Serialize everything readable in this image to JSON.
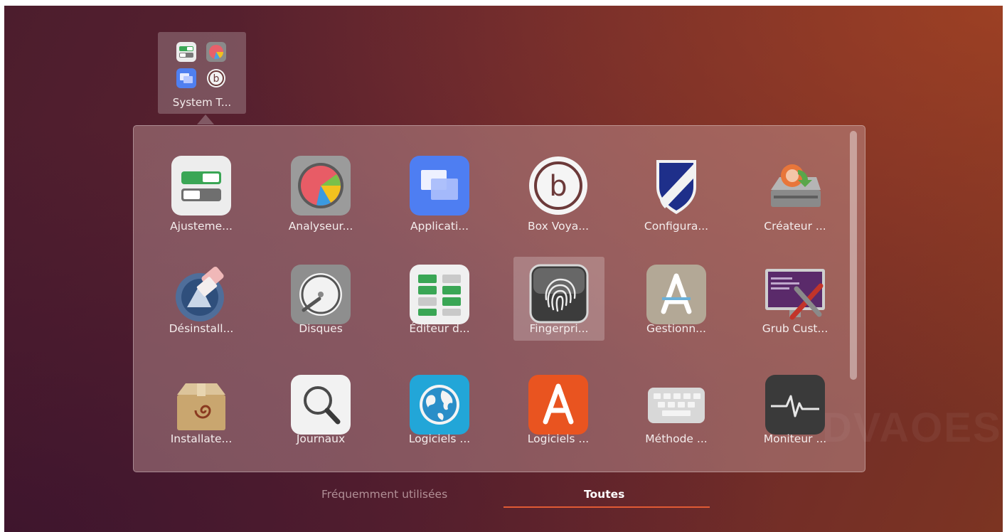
{
  "folder": {
    "label": "System T...",
    "mini_icons": [
      "switch-icon",
      "pie-chart-icon",
      "windows-icon",
      "box-b-icon"
    ]
  },
  "apps": [
    {
      "label": "Ajusteme...",
      "icon": "switch-toggle-icon"
    },
    {
      "label": "Analyseur...",
      "icon": "pie-chart-icon"
    },
    {
      "label": "Applicati...",
      "icon": "windows-icon"
    },
    {
      "label": "Box Voya...",
      "icon": "box-b-icon"
    },
    {
      "label": "Configura...",
      "icon": "shield-icon"
    },
    {
      "label": "Créateur ...",
      "icon": "disk-creator-icon"
    },
    {
      "label": "Désinstall...",
      "icon": "uninstaller-icon"
    },
    {
      "label": "Disques",
      "icon": "disk-icon"
    },
    {
      "label": "Éditeur d...",
      "icon": "grid-editor-icon"
    },
    {
      "label": "Fingerpri...",
      "icon": "fingerprint-icon"
    },
    {
      "label": "Gestionn...",
      "icon": "software-manager-icon"
    },
    {
      "label": "Grub Cust...",
      "icon": "grub-customizer-icon"
    },
    {
      "label": "Installate...",
      "icon": "package-installer-icon"
    },
    {
      "label": "Journaux",
      "icon": "magnifier-icon"
    },
    {
      "label": "Logiciels ...",
      "icon": "globe-icon"
    },
    {
      "label": "Logiciels ...",
      "icon": "ubuntu-software-icon"
    },
    {
      "label": "Méthode ...",
      "icon": "keyboard-icon"
    },
    {
      "label": "Moniteur ...",
      "icon": "system-monitor-icon"
    }
  ],
  "tabs": {
    "frequent": "Fréquemment utilisées",
    "all": "Toutes"
  },
  "colors": {
    "accent": "#e05a34"
  }
}
